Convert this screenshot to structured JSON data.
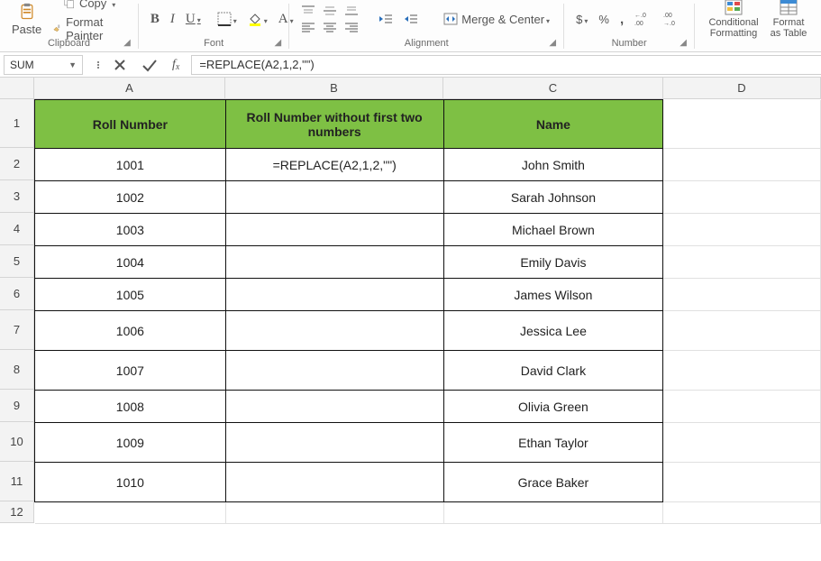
{
  "ribbon": {
    "paste_label": "Paste",
    "copy_label": "Copy",
    "format_painter_label": "Format Painter",
    "merge_center_label": "Merge & Center",
    "conditional_formatting_label": "Conditional Formatting",
    "format_table_label": "Format as Table",
    "currency_symbol": "$",
    "percent_symbol": "%",
    "comma_symbol": ",",
    "increase_decimal": "←.0\n.00",
    "decrease_decimal": ".00\n→.0",
    "groups": {
      "clipboard": "Clipboard",
      "font": "Font",
      "alignment": "Alignment",
      "number": "Number"
    }
  },
  "formula_bar": {
    "name_box_value": "SUM",
    "formula_text": "=REPLACE(A2,1,2,\"\")"
  },
  "columns": [
    "A",
    "B",
    "C",
    "D"
  ],
  "row_labels": [
    "1",
    "2",
    "3",
    "4",
    "5",
    "6",
    "7",
    "8",
    "9",
    "10",
    "11",
    "12"
  ],
  "headers": {
    "A": "Roll Number",
    "B": "Roll Number without first two numbers",
    "C": "Name"
  },
  "data_rows": [
    {
      "roll": "1001",
      "formula": "=REPLACE(A2,1,2,\"\")",
      "name": "John Smith"
    },
    {
      "roll": "1002",
      "formula": "",
      "name": "Sarah Johnson"
    },
    {
      "roll": "1003",
      "formula": "",
      "name": "Michael Brown"
    },
    {
      "roll": "1004",
      "formula": "",
      "name": "Emily Davis"
    },
    {
      "roll": "1005",
      "formula": "",
      "name": "James Wilson"
    },
    {
      "roll": "1006",
      "formula": "",
      "name": "Jessica Lee"
    },
    {
      "roll": "1007",
      "formula": "",
      "name": "David Clark"
    },
    {
      "roll": "1008",
      "formula": "",
      "name": "Olivia Green"
    },
    {
      "roll": "1009",
      "formula": "",
      "name": "Ethan Taylor"
    },
    {
      "roll": "1010",
      "formula": "",
      "name": "Grace Baker"
    }
  ]
}
